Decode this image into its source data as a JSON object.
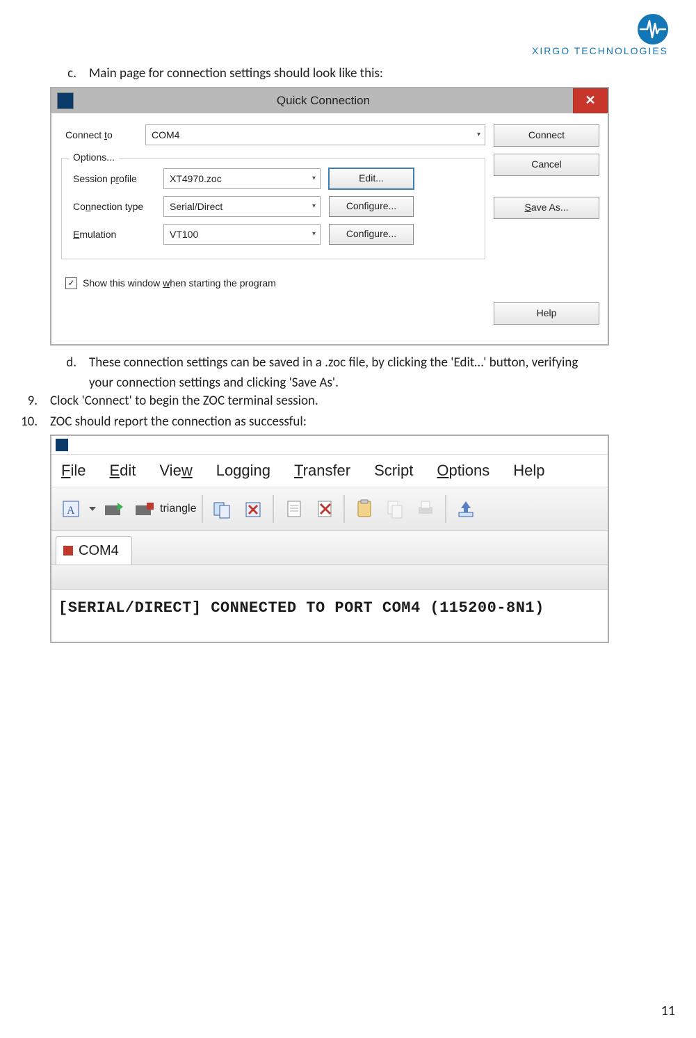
{
  "logo_text": "XIRGO TECHNOLOGIES",
  "items": {
    "c_marker": "c.",
    "c_text": "Main page for connection settings should look like this:",
    "d_marker": "d.",
    "d_line1": "These connection settings can be saved in a .zoc file, by clicking the 'Edit…' button, verifying",
    "d_line2": "your connection settings and clicking 'Save As'.",
    "n9_marker": "9.",
    "n9_text": "Clock 'Connect' to begin the ZOC terminal session.",
    "n10_marker": "10.",
    "n10_text": "ZOC should report the connection as successful:"
  },
  "dialog": {
    "title": "Quick Connection",
    "close": "✕",
    "connect_to_label": "Connect to",
    "connect_to_value": "COM4",
    "options_legend": "Options...",
    "session_profile_label": "Session profile",
    "session_profile_value": "XT4970.zoc",
    "edit_btn": "Edit...",
    "connection_type_label": "Connection type",
    "connection_type_value": "Serial/Direct",
    "configure_btn": "Configure...",
    "emulation_label": "Emulation",
    "emulation_value": "VT100",
    "checkbox_label": "Show this window when starting the program",
    "btn_connect": "Connect",
    "btn_cancel": "Cancel",
    "btn_saveas": "Save As...",
    "btn_help": "Help"
  },
  "terminal": {
    "menu": [
      "File",
      "Edit",
      "View",
      "Logging",
      "Transfer",
      "Script",
      "Options",
      "Help"
    ],
    "tab_label": "COM4",
    "output": "[SERIAL/DIRECT]  CONNECTED  TO  PORT  COM4  (115200-8N1)"
  },
  "page_number": "11"
}
